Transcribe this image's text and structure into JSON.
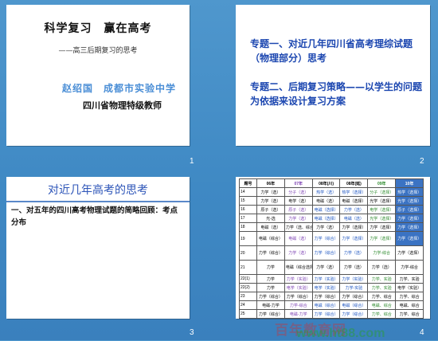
{
  "slide1": {
    "title": "科学复习　赢在高考",
    "subtitle": "——高三后期复习的思考",
    "author": "赵绍国　成都市实验中学",
    "role": "四川省物理特级教师",
    "number": "1"
  },
  "slide2": {
    "topic1": "专题一、对近几年四川省高考理综试题（物理部分）思考",
    "topic2": "专题二、后期复习策略——以学生的问题为依据来设计复习方案",
    "number": "2"
  },
  "slide3": {
    "heading": "对近几年高考的思考",
    "body": "一、对五年的四川高考物理试题的简略回顾：考点分布",
    "number": "3"
  },
  "slide4": {
    "number": "4",
    "headers": [
      "题号",
      "06年",
      "07年",
      "08年(川)",
      "08年(延)",
      "09年",
      "10年"
    ],
    "rows": [
      [
        "14",
        "力学（选）",
        "分子（选）",
        "热学（选）",
        "热学（选择）",
        "分子（选择）",
        "热学（选择）"
      ],
      [
        "15",
        "力学（选）",
        "电学（选）",
        "电磁（选）",
        "电磁（选择）",
        "光学（选择）",
        "光学（选择）"
      ],
      [
        "16",
        "原子（选）",
        "原子（选）",
        "电磁（选择）",
        "力学（选）",
        "电学（选择）",
        "原子（选择）"
      ],
      [
        "17",
        "光-选",
        "力学（选）",
        "电磁（选择）",
        "电磁（选）",
        "光学（选择）",
        "力学（选择）"
      ],
      [
        "18",
        "电磁（选）",
        "力学（选、综合）",
        "力学（选）",
        "力学（选择）",
        "力学（选择）",
        "力学（选择）"
      ],
      [
        "19",
        "电磁（综合）",
        "电磁（选）",
        "力学（综合）",
        "力学（选择）",
        "力学（选择）",
        "力学（选择）"
      ],
      [
        "20",
        "力学（综合）",
        "力学（选）",
        "力学（综合）",
        "力学（选）",
        "力学-综合",
        "力学（选择）"
      ],
      [
        "21",
        "力学",
        "电磁（综合选择）",
        "力学（选）",
        "力学（选）",
        "力学（选）",
        "力学-综合"
      ],
      [
        "22(1)",
        "力学",
        "力学（实验）",
        "力学（实验）",
        "力学（实验）",
        "力学、实验",
        "力学、实验"
      ],
      [
        "22(2)",
        "力学",
        "电学（实验）",
        "电学（实验）",
        "力学-实验",
        "力学、实验",
        "电学（实验）"
      ],
      [
        "23",
        "力学（综合）",
        "力学（综合）",
        "力学（综合）",
        "力学（综合）",
        "力学、综合",
        "力学、综合"
      ],
      [
        "24",
        "电磁-力学",
        "力学-综合",
        "电磁（综合）",
        "电磁（综合）",
        "电磁、综合",
        "电磁、综合"
      ],
      [
        "25",
        "力学（综合）",
        "电磁-力学",
        "力学（综合）",
        "力学（综合）",
        "力学、综合",
        "力学、综合"
      ]
    ]
  },
  "watermark": {
    "line1": "百年教育网",
    "line2": "www.ht88.com"
  }
}
